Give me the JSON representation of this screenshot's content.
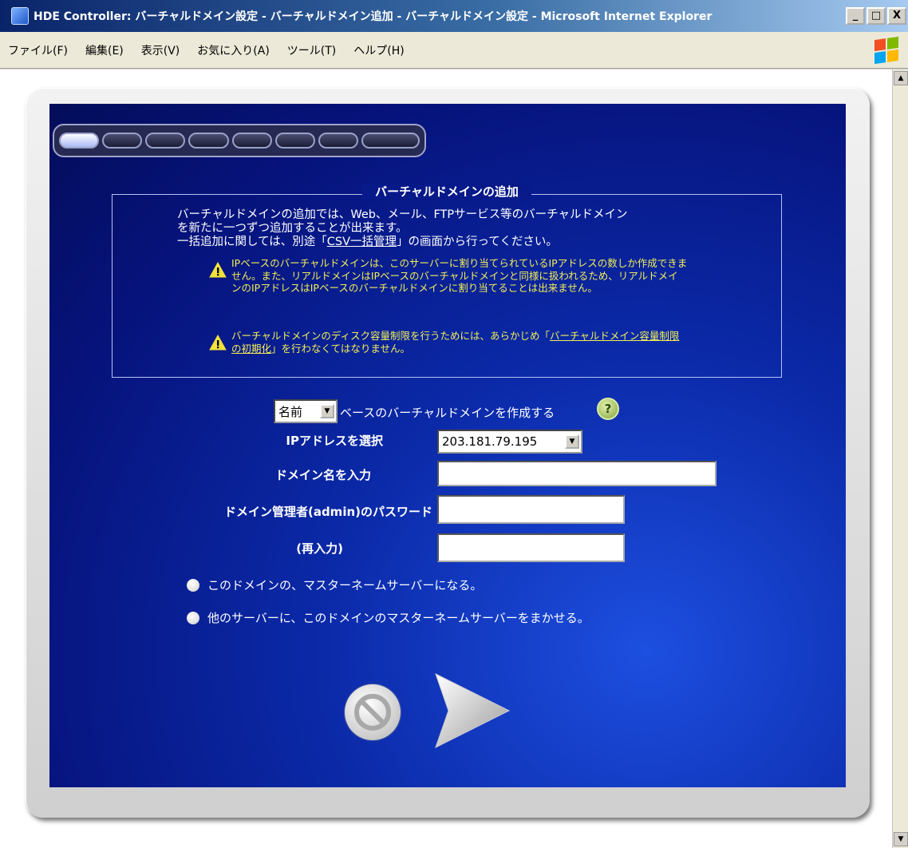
{
  "window": {
    "title": "HDE Controller: バーチャルドメイン設定 - バーチャルドメイン追加 - バーチャルドメイン設定 - Microsoft Internet Explorer",
    "buttons": {
      "minimize": "_",
      "maximize": "□",
      "close": "X"
    }
  },
  "menu": {
    "items": [
      "ファイル(F)",
      "編集(E)",
      "表示(V)",
      "お気に入り(A)",
      "ツール(T)",
      "ヘルプ(H)"
    ]
  },
  "progress": {
    "total_steps": 9,
    "current_step": 1
  },
  "info": {
    "title": "バーチャルドメインの追加",
    "line1": "バーチャルドメインの追加では、Web、メール、FTPサービス等のバーチャルドメイン",
    "line2": "を新たに一つずつ追加することが出来ます。",
    "line3_prefix": "一括追加に関しては、別途「",
    "line3_link": "CSV一括管理",
    "line3_suffix": "」の画面から行ってください。",
    "warning1": "IPベースのバーチャルドメインは、このサーバーに割り当てられているIPアドレスの数しか作成できません。また、リアルドメインはIPベースのバーチャルドメインと同様に扱われるため、リアルドメインのIPアドレスはIPベースのバーチャルドメインに割り当てることは出来ません。",
    "warning2_prefix": "バーチャルドメインのディスク容量制限を行うためには、あらかじめ「",
    "warning2_link": "バーチャルドメイン容量制限の初期化",
    "warning2_suffix": "」を行わなくてはなりません。"
  },
  "form": {
    "base_type_selected": "名前",
    "base_type_suffix": "ベースのバーチャルドメインを作成する",
    "help_symbol": "?",
    "ip_label": "IPアドレスを選択",
    "ip_selected": "203.181.79.195",
    "domain_label": "ドメイン名を入力",
    "domain_value": "",
    "password_label": "ドメイン管理者(admin)のパスワード",
    "password_value": "",
    "reenter_label": "(再入力)",
    "reenter_value": "",
    "radio1_label": "このドメインの、マスターネームサーバーになる。",
    "radio2_label": "他のサーバーに、このドメインのマスターネームサーバーをまかせる。"
  },
  "icons": {
    "warning": "warning-icon",
    "help": "help-icon",
    "cancel": "cancel-icon",
    "next": "next-arrow-icon"
  },
  "colors": {
    "panel_blue": "#0b2aa9",
    "warning_text": "#f2ee57",
    "title_bar": "#0a246a"
  }
}
